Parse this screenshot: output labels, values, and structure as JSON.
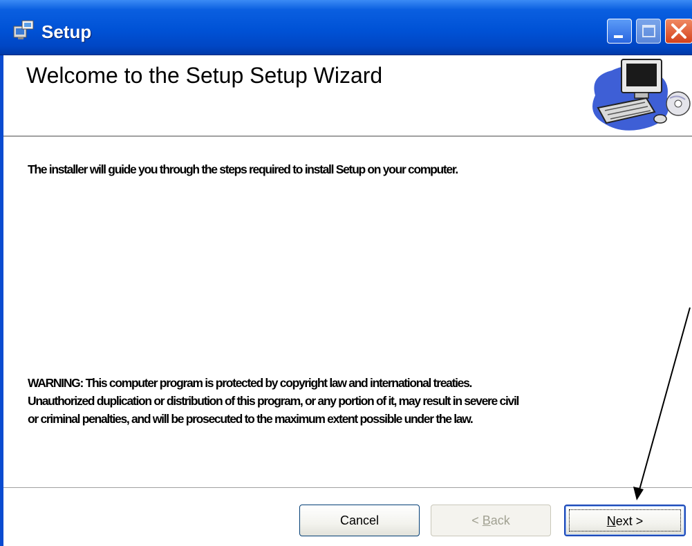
{
  "window": {
    "title": "Setup",
    "icon": "installer-icon"
  },
  "banner": {
    "title": "Welcome to the Setup Setup Wizard",
    "image": "computer-cd-illustration"
  },
  "content": {
    "intro": "The installer will guide you through the steps required to install Setup on your computer.",
    "warning_lines": [
      "WARNING: This computer program is protected by copyright law and international treaties.",
      "Unauthorized duplication or distribution of this program, or any portion of it, may result in severe civil",
      "or criminal penalties, and will be prosecuted to the maximum extent possible under the law."
    ]
  },
  "buttons": {
    "cancel": "Cancel",
    "back_prefix": "< ",
    "back_key": "B",
    "back_rest": "ack",
    "next_key": "N",
    "next_rest": "ext >"
  },
  "colors": {
    "titlebar": "#0052d6",
    "close_button": "#d4411c",
    "button_border": "#003c74"
  }
}
